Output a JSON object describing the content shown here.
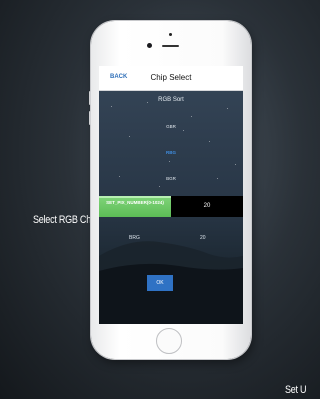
{
  "captions": {
    "left": "Select RGB Chip",
    "bottom_right": "Set U"
  },
  "nav": {
    "back_label": "BACK",
    "title": "Chip Select"
  },
  "rgb_sort": {
    "title": "RGB Sort",
    "options": [
      "GBR",
      "RBG",
      "BGR"
    ],
    "selected": "RBG"
  },
  "picker": {
    "left_label": "SET_PIX_NUMBER(0-1024)",
    "right_value": "20"
  },
  "lower_row": {
    "left_label": "BRG",
    "right_value": "20"
  },
  "ok_button": {
    "label": "OK"
  },
  "colors": {
    "accent": "#2f72c4",
    "selected_option": "#3f8de0",
    "picker_highlight": "#5cbc56"
  },
  "icons": {
    "home_button": "home-button-ring",
    "camera": "camera-dot"
  }
}
